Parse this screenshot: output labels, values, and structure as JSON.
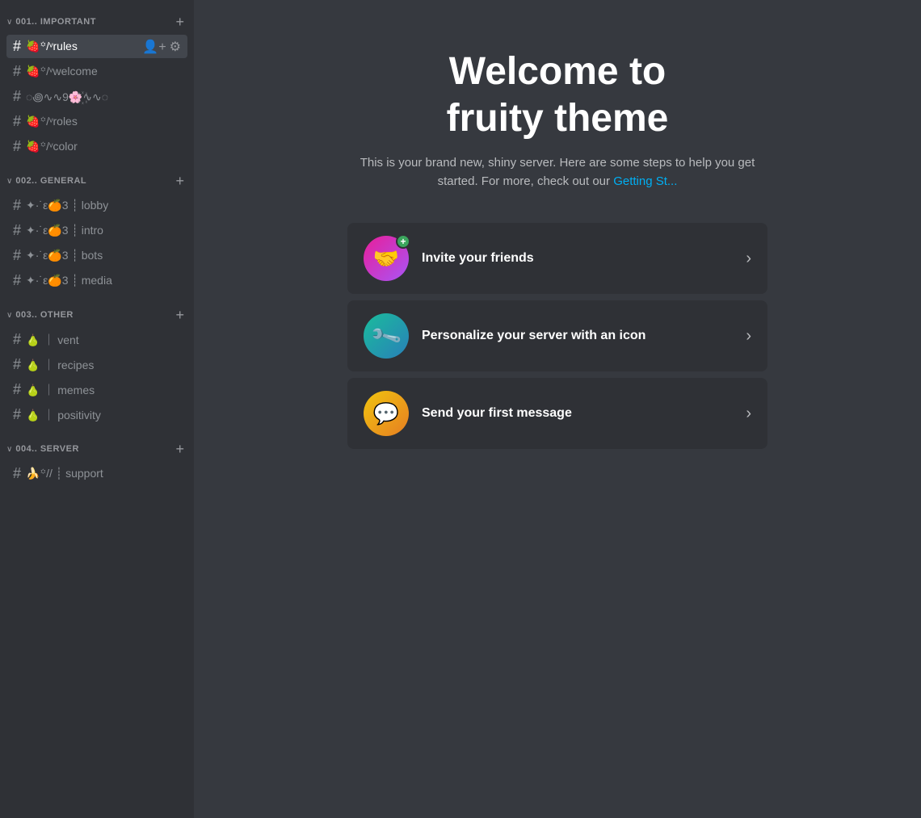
{
  "sidebar": {
    "categories": [
      {
        "id": "important",
        "label": "001.. IMPORTANT",
        "chevron": "∨",
        "channels": [
          {
            "id": "rules",
            "name": "🍓꙳/ᵛrules",
            "active": true
          },
          {
            "id": "welcome",
            "name": "🍓꙳/ᵛwelcome",
            "active": false
          },
          {
            "id": "decorative",
            "name": "◌꩜∿∿9🌸꙰∿∿◌",
            "active": false
          },
          {
            "id": "roles",
            "name": "🍓꙳/ᵛroles",
            "active": false
          },
          {
            "id": "color",
            "name": "🍓꙳/ᵛcolor",
            "active": false
          }
        ]
      },
      {
        "id": "general",
        "label": "002.. GENERAL",
        "chevron": "∨",
        "channels": [
          {
            "id": "lobby",
            "name": "✦·˙ε🍊3 ┊ lobby",
            "active": false
          },
          {
            "id": "intro",
            "name": "✦·˙ε🍊3 ┊ intro",
            "active": false
          },
          {
            "id": "bots",
            "name": "✦·˙ε🍊3 ┊ bots",
            "active": false
          },
          {
            "id": "media",
            "name": "✦·˙ε🍊3 ┊ media",
            "active": false
          }
        ]
      },
      {
        "id": "other",
        "label": "003.. OTHER",
        "chevron": "∨",
        "channels": [
          {
            "id": "vent",
            "name": "🍐 ｜ vent",
            "active": false
          },
          {
            "id": "recipes",
            "name": "🍐 ｜ recipes",
            "active": false
          },
          {
            "id": "memes",
            "name": "🍐 ｜ memes",
            "active": false
          },
          {
            "id": "positivity",
            "name": "🍐 ｜ positivity",
            "active": false
          }
        ]
      },
      {
        "id": "server",
        "label": "004.. SERVER",
        "chevron": "∨",
        "channels": [
          {
            "id": "support",
            "name": "🍌꙳// ┊ support",
            "active": false
          }
        ]
      }
    ]
  },
  "main": {
    "welcome_title_line1": "Welcome to",
    "welcome_title_line2": "fruity theme",
    "welcome_desc": "This is your brand new, shiny server. Here are some steps to help you get started. For more, check out our",
    "welcome_link_text": "Getting St...",
    "actions": [
      {
        "id": "invite",
        "label": "Invite your friends",
        "icon_type": "purple",
        "icon_emoji": "🧑‍🤝‍🧑",
        "has_badge": true,
        "badge_symbol": "+"
      },
      {
        "id": "personalize",
        "label": "Personalize your server with an icon",
        "icon_type": "teal",
        "icon_emoji": "🎨",
        "has_badge": false
      },
      {
        "id": "send_message",
        "label": "Send your first message",
        "icon_type": "yellow",
        "icon_emoji": "💬",
        "has_badge": false
      }
    ]
  }
}
